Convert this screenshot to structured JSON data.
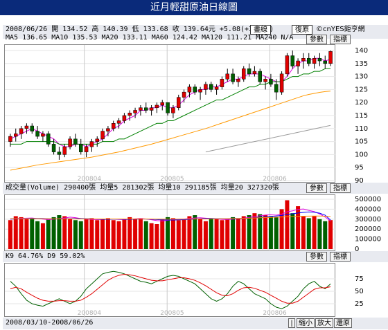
{
  "window": {
    "title": "近月輕甜原油日線圖"
  },
  "price_header": {
    "line1": "2008/06/26 開 134.52 高 140.39 低 133.68 收 139.64元 +5.08(+3.78%)",
    "line2": "MA5 136.65  MA10 135.53  MA20 133.11  MA60 124.42  MA120 111.21  MA240 N/A",
    "btn_draw": "畫線",
    "btn_restore": "復原",
    "copyright": "©cnYES鉅亨網",
    "btn_params": "參數",
    "btn_indicator": "指標"
  },
  "volume_header": {
    "text": "成交量(Volume) 290400張  均量5 281302張  均量10 291185張  均量20 327320張",
    "btn_params": "參數",
    "btn_indicator": "指標"
  },
  "kd_header": {
    "text": "K9 64.76%  D9 59.02%",
    "btn_params": "參數",
    "btn_indicator": "指標"
  },
  "footer": {
    "date_range": "2008/03/10-2008/06/26",
    "btn_prev": "|",
    "btn_zoom_out": "縮小",
    "btn_zoom_in": "放大",
    "btn_reset": "還原"
  },
  "colors": {
    "up": "#e00000",
    "down": "#006000",
    "ma5": "#e000e0",
    "ma20": "#008000",
    "ma60": "#ff9900",
    "ma120": "#999999",
    "grid": "#c8c8c8",
    "title_bg": "#0a2a7a"
  },
  "chart_data": [
    {
      "type": "candlestick",
      "title": "近月輕甜原油日線圖",
      "x_labels": [
        "200804",
        "200805",
        "200806"
      ],
      "ylim": [
        90,
        140
      ],
      "yticks": [
        90,
        95,
        100,
        105,
        110,
        115,
        120,
        125,
        130,
        135,
        140
      ],
      "ohlc": [
        [
          105,
          108,
          103,
          107
        ],
        [
          107,
          110,
          105,
          108
        ],
        [
          108,
          111,
          106,
          110
        ],
        [
          110,
          112,
          108,
          111
        ],
        [
          111,
          112,
          108,
          109
        ],
        [
          109,
          111,
          106,
          107
        ],
        [
          107,
          109,
          105,
          108
        ],
        [
          108,
          109,
          103,
          104
        ],
        [
          104,
          106,
          100,
          101
        ],
        [
          101,
          103,
          98,
          100
        ],
        [
          100,
          104,
          99,
          103
        ],
        [
          103,
          107,
          102,
          106
        ],
        [
          106,
          108,
          103,
          104
        ],
        [
          104,
          106,
          100,
          101
        ],
        [
          101,
          104,
          99,
          103
        ],
        [
          103,
          106,
          101,
          105
        ],
        [
          105,
          107,
          103,
          106
        ],
        [
          106,
          110,
          105,
          109
        ],
        [
          109,
          111,
          107,
          110
        ],
        [
          110,
          113,
          109,
          112
        ],
        [
          112,
          114,
          110,
          113
        ],
        [
          113,
          116,
          112,
          115
        ],
        [
          115,
          117,
          113,
          116
        ],
        [
          116,
          118,
          114,
          117
        ],
        [
          117,
          119,
          115,
          118
        ],
        [
          118,
          120,
          116,
          117
        ],
        [
          117,
          119,
          115,
          118
        ],
        [
          118,
          120,
          116,
          119
        ],
        [
          119,
          121,
          117,
          120
        ],
        [
          120,
          120,
          115,
          116
        ],
        [
          116,
          119,
          114,
          118
        ],
        [
          118,
          123,
          117,
          122
        ],
        [
          122,
          125,
          120,
          124
        ],
        [
          124,
          127,
          122,
          126
        ],
        [
          126,
          127,
          123,
          124
        ],
        [
          124,
          126,
          121,
          125
        ],
        [
          125,
          128,
          123,
          127
        ],
        [
          127,
          128,
          124,
          125
        ],
        [
          125,
          127,
          123,
          126
        ],
        [
          126,
          130,
          125,
          129
        ],
        [
          129,
          133,
          128,
          131
        ],
        [
          131,
          133,
          127,
          128
        ],
        [
          128,
          130,
          126,
          129
        ],
        [
          129,
          134,
          128,
          133
        ],
        [
          133,
          135,
          130,
          131
        ],
        [
          131,
          134,
          130,
          132
        ],
        [
          132,
          133,
          127,
          128
        ],
        [
          128,
          130,
          125,
          129
        ],
        [
          129,
          131,
          126,
          127
        ],
        [
          127,
          129,
          121,
          124
        ],
        [
          124,
          132,
          123,
          131
        ],
        [
          131,
          139,
          130,
          138
        ],
        [
          138,
          140,
          133,
          134
        ],
        [
          134,
          137,
          131,
          136
        ],
        [
          136,
          139,
          133,
          137
        ],
        [
          137,
          139,
          134,
          135
        ],
        [
          135,
          138,
          133,
          137
        ],
        [
          137,
          139,
          134,
          136
        ],
        [
          136,
          138,
          133,
          135
        ],
        [
          135,
          140,
          134,
          139.64
        ]
      ],
      "series": [
        {
          "name": "MA5",
          "values": [
            106,
            107,
            108,
            109,
            110,
            109,
            108,
            107,
            106,
            104,
            103,
            103,
            104,
            104,
            103,
            104,
            105,
            106,
            108,
            110,
            111,
            113,
            114,
            115,
            117,
            117,
            118,
            118,
            119,
            118,
            118,
            119,
            121,
            123,
            124,
            125,
            125,
            126,
            126,
            127,
            128,
            129,
            129,
            130,
            131,
            131,
            131,
            130,
            129,
            128,
            128,
            130,
            133,
            135,
            136,
            136,
            137,
            137,
            136,
            136.65
          ]
        },
        {
          "name": "MA20",
          "values": [
            104,
            104,
            104,
            105,
            105,
            105,
            105,
            105,
            105,
            104,
            104,
            104,
            104,
            104,
            104,
            104,
            104,
            105,
            105,
            105,
            106,
            106,
            107,
            108,
            109,
            110,
            111,
            112,
            112,
            113,
            113,
            114,
            115,
            116,
            117,
            118,
            119,
            120,
            121,
            121,
            122,
            123,
            124,
            125,
            126,
            126,
            127,
            127,
            128,
            128,
            128,
            129,
            130,
            130,
            131,
            131,
            132,
            132,
            133,
            133.11
          ]
        },
        {
          "name": "MA60",
          "values": [
            94,
            94.4,
            94.8,
            95.2,
            95.6,
            96,
            96.3,
            96.6,
            96.9,
            97.2,
            97.5,
            97.8,
            98.1,
            98.4,
            98.7,
            99,
            99.4,
            99.8,
            100.2,
            100.6,
            101,
            101.5,
            102,
            102.5,
            103,
            103.5,
            104,
            104.6,
            105.2,
            105.8,
            106.4,
            107,
            107.6,
            108.2,
            108.8,
            109.4,
            110,
            110.7,
            111.4,
            112.1,
            112.8,
            113.5,
            114.2,
            114.9,
            115.6,
            116.3,
            117,
            117.7,
            118.4,
            119.1,
            119.8,
            120.5,
            121.2,
            121.9,
            122.6,
            123.1,
            123.5,
            123.9,
            124.2,
            124.42
          ]
        },
        {
          "name": "MA120",
          "points": [
            [
              36,
              101
            ],
            [
              59,
              111.21
            ]
          ]
        }
      ]
    },
    {
      "type": "bar",
      "title": "成交量(Volume)",
      "ylim": [
        0,
        500000
      ],
      "yticks": [
        0,
        100000,
        200000,
        300000,
        400000,
        500000
      ],
      "values": [
        290000,
        330000,
        320000,
        300000,
        310000,
        280000,
        260000,
        300000,
        320000,
        340000,
        330000,
        300000,
        290000,
        280000,
        300000,
        310000,
        290000,
        300000,
        310000,
        290000,
        280000,
        300000,
        320000,
        300000,
        310000,
        280000,
        260000,
        250000,
        300000,
        320000,
        310000,
        290000,
        300000,
        330000,
        340000,
        300000,
        280000,
        310000,
        300000,
        290000,
        300000,
        320000,
        310000,
        330000,
        340000,
        360000,
        350000,
        340000,
        330000,
        320000,
        400000,
        490000,
        360000,
        430000,
        330000,
        310000,
        330000,
        300000,
        280000,
        290400
      ],
      "series": [
        {
          "name": "均量5",
          "values": [
            300000,
            305000,
            308000,
            310000,
            312000,
            306000,
            300000,
            295000,
            300000,
            305000,
            312000,
            320000,
            315000,
            306000,
            300000,
            298000,
            296000,
            298000,
            300000,
            302000,
            298000,
            296000,
            300000,
            304000,
            306000,
            302000,
            294000,
            286000,
            282000,
            288000,
            296000,
            300000,
            302000,
            306000,
            312000,
            314000,
            310000,
            306000,
            302000,
            298000,
            296000,
            300000,
            304000,
            310000,
            318000,
            326000,
            334000,
            342000,
            344000,
            340000,
            350000,
            374000,
            384000,
            398000,
            402000,
            388000,
            376000,
            352000,
            322000,
            281302
          ]
        },
        {
          "name": "均量10",
          "values": [
            300000,
            302000,
            304000,
            306000,
            307000,
            307000,
            306000,
            304000,
            302000,
            302000,
            303000,
            305000,
            306000,
            306000,
            305000,
            303000,
            301000,
            299000,
            299000,
            300000,
            300000,
            299000,
            299000,
            300000,
            301000,
            301000,
            299000,
            296000,
            293000,
            292000,
            292000,
            293000,
            295000,
            298000,
            301000,
            304000,
            306000,
            306000,
            305000,
            304000,
            303000,
            303000,
            304000,
            306000,
            309000,
            313000,
            318000,
            323000,
            328000,
            332000,
            338000,
            346000,
            354000,
            362000,
            368000,
            372000,
            370000,
            360000,
            340000,
            291185
          ]
        },
        {
          "name": "均量20",
          "values": [
            305000,
            305000,
            305000,
            305000,
            305000,
            305000,
            304000,
            304000,
            304000,
            303000,
            303000,
            303000,
            303000,
            303000,
            303000,
            302000,
            302000,
            302000,
            302000,
            302000,
            302000,
            302000,
            302000,
            302000,
            302000,
            301000,
            301000,
            300000,
            300000,
            300000,
            300000,
            300000,
            300000,
            301000,
            301000,
            302000,
            302000,
            303000,
            303000,
            304000,
            305000,
            306000,
            307000,
            308000,
            310000,
            312000,
            314000,
            316000,
            318000,
            320000,
            322000,
            324000,
            326000,
            328000,
            330000,
            331000,
            332000,
            332000,
            330000,
            327320
          ]
        }
      ]
    },
    {
      "type": "line",
      "title": "KD",
      "ylim": [
        0,
        100
      ],
      "yticks": [
        25,
        50,
        75
      ],
      "series": [
        {
          "name": "K9",
          "values": [
            70,
            60,
            45,
            32,
            25,
            22,
            20,
            25,
            30,
            35,
            30,
            25,
            30,
            40,
            55,
            65,
            75,
            85,
            88,
            90,
            88,
            85,
            80,
            75,
            70,
            68,
            65,
            70,
            75,
            80,
            82,
            80,
            75,
            70,
            65,
            55,
            45,
            35,
            30,
            35,
            45,
            60,
            70,
            65,
            55,
            45,
            40,
            35,
            25,
            18,
            15,
            20,
            30,
            40,
            55,
            65,
            70,
            60,
            55,
            64.76
          ]
        },
        {
          "name": "D9",
          "values": [
            55,
            58,
            55,
            48,
            42,
            36,
            32,
            30,
            30,
            31,
            31,
            30,
            30,
            32,
            38,
            45,
            54,
            63,
            72,
            78,
            82,
            84,
            83,
            81,
            78,
            75,
            72,
            71,
            71,
            73,
            75,
            77,
            77,
            75,
            72,
            67,
            61,
            54,
            47,
            42,
            41,
            45,
            52,
            57,
            58,
            56,
            52,
            48,
            42,
            36,
            30,
            26,
            26,
            30,
            38,
            46,
            54,
            57,
            57,
            59.02
          ]
        }
      ]
    }
  ]
}
